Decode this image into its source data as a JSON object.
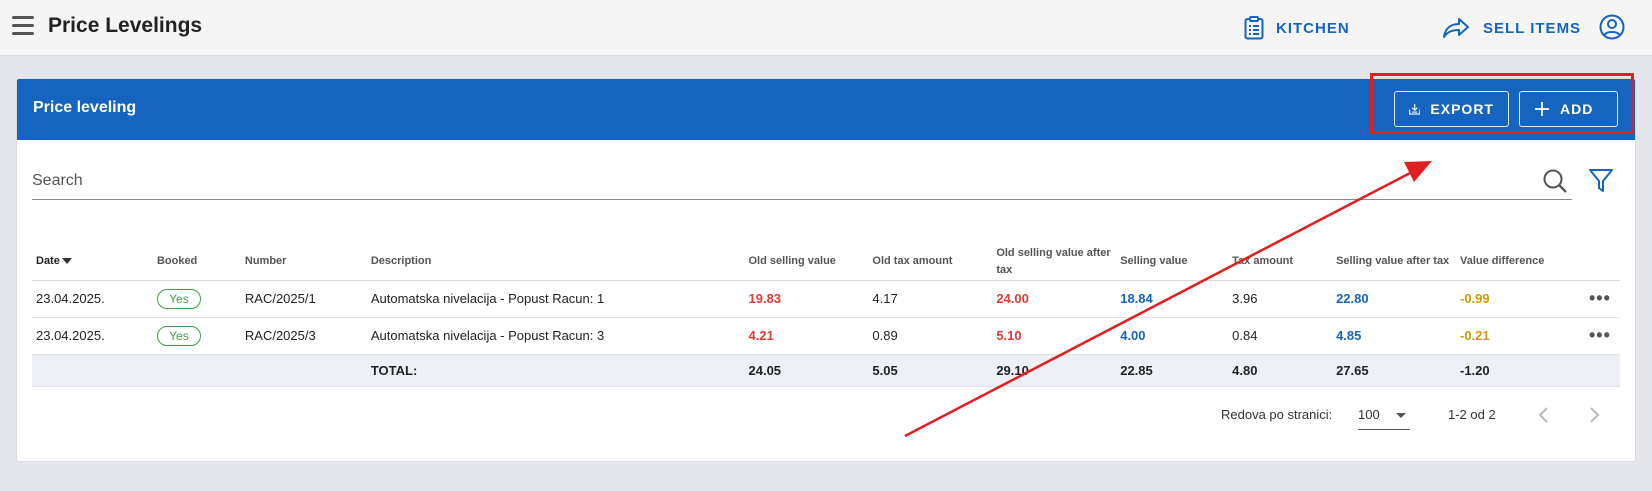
{
  "topbar": {
    "title": "Price Levelings",
    "kitchen_label": "KITCHEN",
    "sell_items_label": "SELL ITEMS"
  },
  "card": {
    "title": "Price leveling",
    "export_label": "EXPORT",
    "add_label": "ADD"
  },
  "search": {
    "placeholder": "Search",
    "value": ""
  },
  "table": {
    "headers": {
      "date": "Date",
      "booked": "Booked",
      "number": "Number",
      "description": "Description",
      "old_selling_value": "Old selling value",
      "old_tax_amount": "Old tax amount",
      "old_selling_value_after_tax": "Old selling value after tax",
      "selling_value": "Selling value",
      "tax_amount": "Tax amount",
      "selling_value_after_tax": "Selling value after tax",
      "value_difference": "Value difference"
    },
    "rows": [
      {
        "date": "23.04.2025.",
        "booked": "Yes",
        "number": "RAC/2025/1",
        "description": "Automatska nivelacija - Popust Racun: 1",
        "old_selling_value": "19.83",
        "old_tax_amount": "4.17",
        "old_selling_value_after_tax": "24.00",
        "selling_value": "18.84",
        "tax_amount": "3.96",
        "selling_value_after_tax": "22.80",
        "value_difference": "-0.99"
      },
      {
        "date": "23.04.2025.",
        "booked": "Yes",
        "number": "RAC/2025/3",
        "description": "Automatska nivelacija - Popust Racun: 3",
        "old_selling_value": "4.21",
        "old_tax_amount": "0.89",
        "old_selling_value_after_tax": "5.10",
        "selling_value": "4.00",
        "tax_amount": "0.84",
        "selling_value_after_tax": "4.85",
        "value_difference": "-0.21"
      }
    ],
    "total": {
      "label": "TOTAL:",
      "old_selling_value": "24.05",
      "old_tax_amount": "5.05",
      "old_selling_value_after_tax": "29.10",
      "selling_value": "22.85",
      "tax_amount": "4.80",
      "selling_value_after_tax": "27.65",
      "value_difference": "-1.20"
    }
  },
  "pagination": {
    "rows_per_page_label": "Redova po stranici:",
    "rows_per_page": "100",
    "range": "1-2 od 2"
  },
  "colors": {
    "primary": "#1565c0",
    "negative_old": "#e53935",
    "difference": "#d69a00",
    "booked": "#43a047",
    "annotation": "#e02020"
  }
}
